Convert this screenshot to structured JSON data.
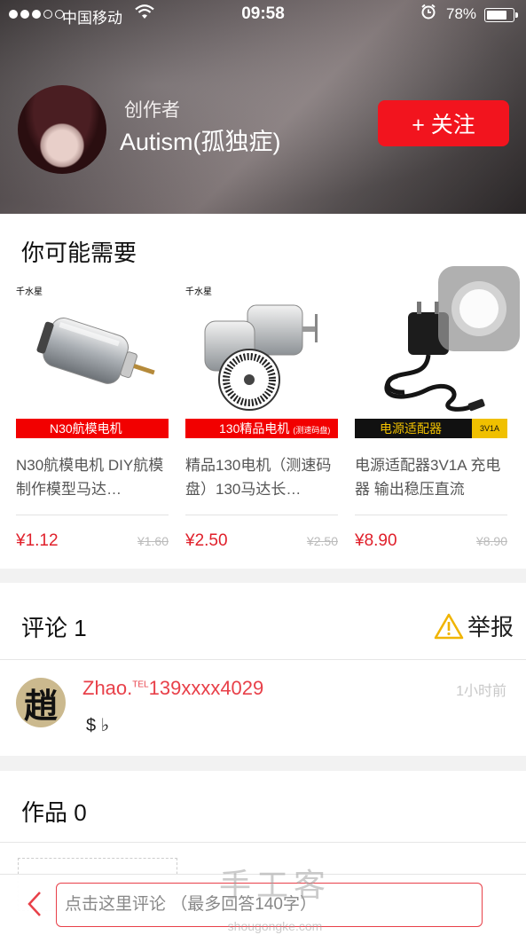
{
  "status_bar": {
    "carrier": "中国移动",
    "time": "09:58",
    "battery": "78%",
    "battery_level": 0.78
  },
  "creator": {
    "label": "创作者",
    "name": "Autism(孤独症)",
    "follow_button": "+ 关注"
  },
  "products_section": {
    "title": "你可能需要",
    "items": [
      {
        "brand": "千水星",
        "banner": "N30航模电机",
        "banner_note": "",
        "banner_color": "#f20000",
        "name": "N30航模电机 DIY航模制作模型马达…",
        "price": "¥1.12",
        "original_price": "¥1.60"
      },
      {
        "brand": "千水星",
        "banner": "130精品电机",
        "banner_note": "(测速码盘)",
        "banner_color": "#f20000",
        "name": "精品130电机（测速码盘）130马达长…",
        "price": "¥2.50",
        "original_price": "¥2.50"
      },
      {
        "brand": "",
        "banner": "电源适配器",
        "banner_note": "3V1A",
        "banner_color": "#111111",
        "name": "电源适配器3V1A 充电器 输出稳压直流",
        "price": "¥8.90",
        "original_price": "¥8.90"
      }
    ]
  },
  "comments_section": {
    "title": "评论 1",
    "report": "举报",
    "items": [
      {
        "avatar_text": "趙",
        "name": "Zhao.",
        "name_sup": "TEL",
        "name_suffix": "139xxxx4029",
        "time": "1小时前",
        "text": "$ ♭"
      }
    ]
  },
  "works_section": {
    "title": "作品 0"
  },
  "bottom_bar": {
    "input_placeholder": "点击这里评论 （最多回答140字）",
    "watermark": "手工客",
    "watermark_url": "shougongke.com"
  },
  "colors": {
    "accent": "#f2141e",
    "link": "#e84049"
  }
}
